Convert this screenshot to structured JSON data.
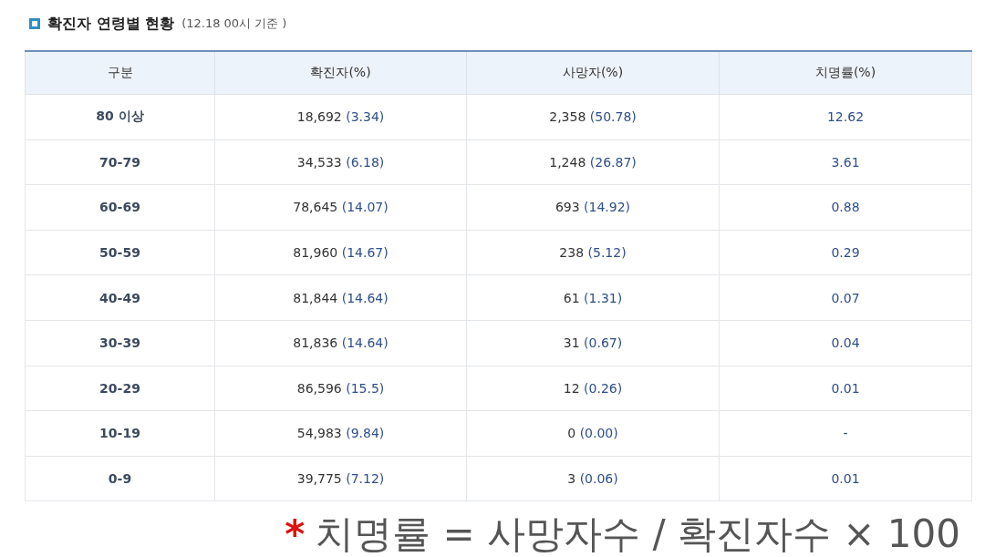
{
  "title": {
    "text": "확진자 연령별 현황",
    "note": "(12.18 00시 기준 )"
  },
  "table": {
    "columns": [
      "구분",
      "확진자(%)",
      "사망자(%)",
      "치명률(%)"
    ],
    "rows": [
      {
        "group": "80 이상",
        "confirmed": {
          "count": "18,692",
          "pct": "(3.34)"
        },
        "deaths": {
          "count": "2,358",
          "pct": "(50.78)"
        },
        "rate": "12.62"
      },
      {
        "group": "70-79",
        "confirmed": {
          "count": "34,533",
          "pct": "(6.18)"
        },
        "deaths": {
          "count": "1,248",
          "pct": "(26.87)"
        },
        "rate": "3.61"
      },
      {
        "group": "60-69",
        "confirmed": {
          "count": "78,645",
          "pct": "(14.07)"
        },
        "deaths": {
          "count": "693",
          "pct": "(14.92)"
        },
        "rate": "0.88"
      },
      {
        "group": "50-59",
        "confirmed": {
          "count": "81,960",
          "pct": "(14.67)"
        },
        "deaths": {
          "count": "238",
          "pct": "(5.12)"
        },
        "rate": "0.29"
      },
      {
        "group": "40-49",
        "confirmed": {
          "count": "81,844",
          "pct": "(14.64)"
        },
        "deaths": {
          "count": "61",
          "pct": "(1.31)"
        },
        "rate": "0.07"
      },
      {
        "group": "30-39",
        "confirmed": {
          "count": "81,836",
          "pct": "(14.64)"
        },
        "deaths": {
          "count": "31",
          "pct": "(0.67)"
        },
        "rate": "0.04"
      },
      {
        "group": "20-29",
        "confirmed": {
          "count": "86,596",
          "pct": "(15.5)"
        },
        "deaths": {
          "count": "12",
          "pct": "(0.26)"
        },
        "rate": "0.01"
      },
      {
        "group": "10-19",
        "confirmed": {
          "count": "54,983",
          "pct": "(9.84)"
        },
        "deaths": {
          "count": "0",
          "pct": "(0.00)"
        },
        "rate": "-"
      },
      {
        "group": "0-9",
        "confirmed": {
          "count": "39,775",
          "pct": "(7.12)"
        },
        "deaths": {
          "count": "3",
          "pct": "(0.06)"
        },
        "rate": "0.01"
      }
    ]
  },
  "footnote": {
    "mark": "*",
    "text": "치명률 = 사망자수 / 확진자수 × 100"
  }
}
